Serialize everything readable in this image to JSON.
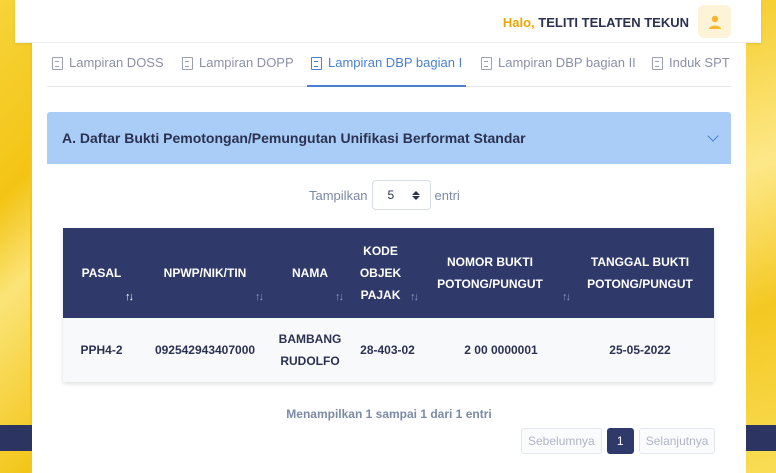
{
  "header": {
    "greeting_prefix": "Halo,",
    "user_name": "TELITI TELATEN TEKUN"
  },
  "tabs": [
    {
      "label": "Lampiran DOSS",
      "active": false
    },
    {
      "label": "Lampiran DOPP",
      "active": false
    },
    {
      "label": "Lampiran DBP bagian I",
      "active": true
    },
    {
      "label": "Lampiran DBP bagian II",
      "active": false
    },
    {
      "label": "Induk SPT",
      "active": false
    }
  ],
  "section": {
    "title": "A. Daftar Bukti Pemotongan/Pemungutan Unifikasi Berformat Standar"
  },
  "length_control": {
    "prefix": "Tampilkan",
    "value": "5",
    "suffix": "entri"
  },
  "table": {
    "headers": [
      "PASAL",
      "NPWP/NIK/TIN",
      "NAMA",
      "KODE OBJEK PAJAK",
      "NOMOR BUKTI POTONG/PUNGUT",
      "TANGGAL BUKTI POTONG/PUNGUT"
    ],
    "rows": [
      [
        "PPH4-2",
        "092542943407000",
        "BAMBANG RUDOLFO",
        "28-403-02",
        "2 00 0000001",
        "25-05-2022"
      ]
    ]
  },
  "footer": {
    "info": "Menampilkan 1 sampai 1 dari 1 entri",
    "prev_label": "Sebelumnya",
    "current_page": "1",
    "next_label": "Selanjutnya"
  },
  "colors": {
    "header_bg": "#2f3a6b",
    "accent": "#4a7fd4",
    "accordion_bg": "#a9cdf6",
    "greeting_accent": "#f0a500"
  }
}
